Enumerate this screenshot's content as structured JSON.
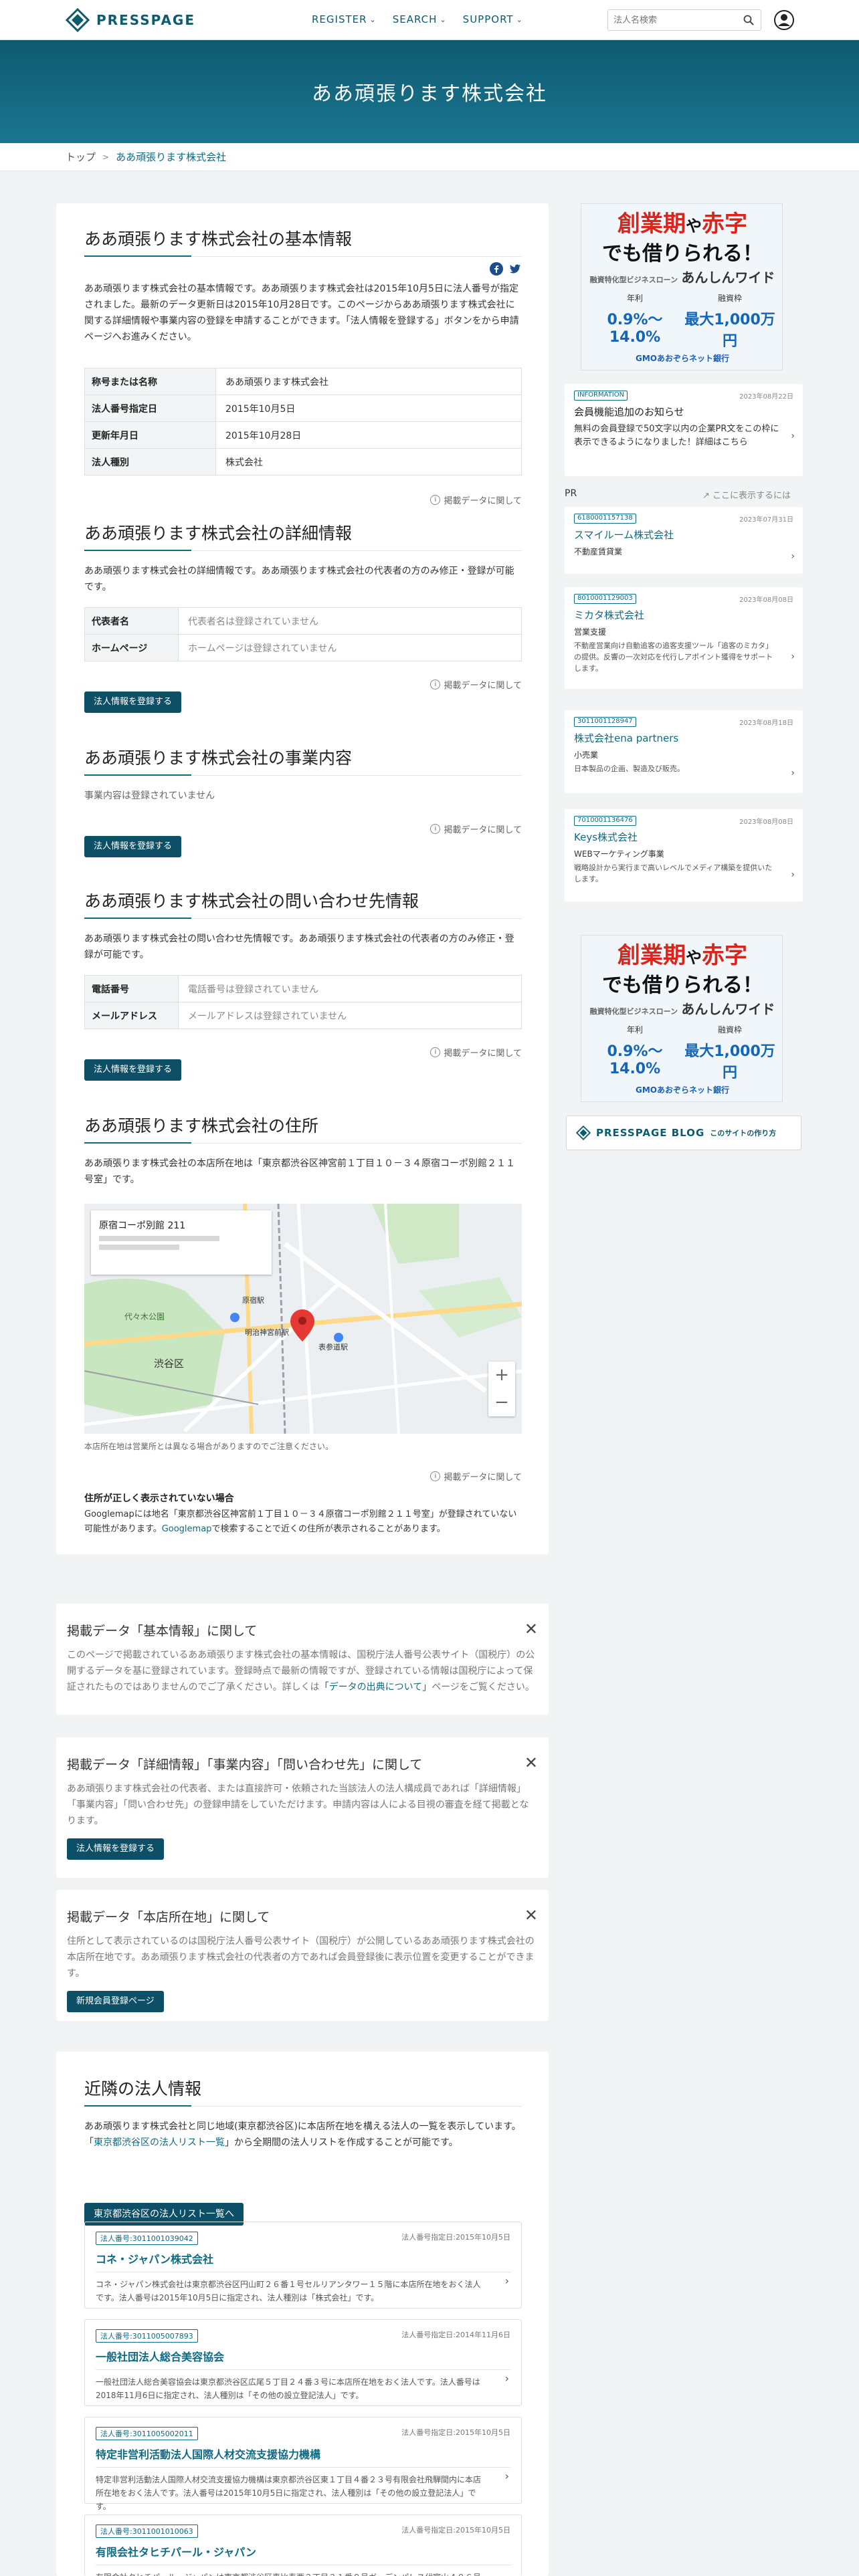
{
  "header": {
    "logo_text": "PRESSPAGE",
    "nav": [
      "REGISTER",
      "SEARCH",
      "SUPPORT"
    ],
    "search_placeholder": "法人名検索"
  },
  "hero": {
    "title": "ああ頑張ります株式会社"
  },
  "breadcrumb": {
    "home": "トップ",
    "sep": ">",
    "current": "ああ頑張ります株式会社"
  },
  "basic": {
    "title": "ああ頑張ります株式会社の基本情報",
    "lead": "ああ頑張ります株式会社の基本情報です。ああ頑張ります株式会社は2015年10月5日に法人番号が指定されました。最新のデータ更新日は2015年10月28日です。このページからああ頑張ります株式会社に関する詳細情報や事業内容の登録を申請することができます。「法人情報を登録する」ボタンをから申請ページへお進みください。",
    "rows": [
      {
        "label": "称号または名称",
        "value": "ああ頑張ります株式会社"
      },
      {
        "label": "法人番号指定日",
        "value": "2015年10月5日"
      },
      {
        "label": "更新年月日",
        "value": "2015年10月28日"
      },
      {
        "label": "法人種別",
        "value": "株式会社"
      }
    ],
    "about": "掲載データに関して"
  },
  "detail": {
    "title": "ああ頑張ります株式会社の詳細情報",
    "lead": "ああ頑張ります株式会社の詳細情報です。ああ頑張ります株式会社の代表者の方のみ修正・登録が可能です。",
    "rows": [
      {
        "label": "代表者名",
        "value": "代表者名は登録されていません"
      },
      {
        "label": "ホームページ",
        "value": "ホームページは登録されていません"
      }
    ],
    "about": "掲載データに関して",
    "button": "法人情報を登録する"
  },
  "business": {
    "title": "ああ頑張ります株式会社の事業内容",
    "lead": "事業内容は登録されていません",
    "about": "掲載データに関して",
    "button": "法人情報を登録する"
  },
  "contact": {
    "title": "ああ頑張ります株式会社の問い合わせ先情報",
    "lead": "ああ頑張ります株式会社の問い合わせ先情報です。ああ頑張ります株式会社の代表者の方のみ修正・登録が可能です。",
    "rows": [
      {
        "label": "電話番号",
        "value": "電話番号は登録されていません"
      },
      {
        "label": "メールアドレス",
        "value": "メールアドレスは登録されていません"
      }
    ],
    "about": "掲載データに関して",
    "button": "法人情報を登録する"
  },
  "address": {
    "title": "ああ頑張ります株式会社の住所",
    "lead": "ああ頑張ります株式会社の本店所在地は「東京都渋谷区神宮前１丁目１０－３４原宿コーポ別館２１１号室」です。",
    "map_card_title": "原宿コーポ別館 211",
    "map_labels": [
      "渋谷区",
      "代々木公園",
      "明治神宮前駅",
      "表参道駅",
      "原宿駅"
    ],
    "map_note": "本店所在地は営業所とは異なる場合がありますのでご注意ください。",
    "about": "掲載データに関して",
    "warn_title": "住所が正しく表示されていない場合",
    "warn_text_1": "Googlemapには地名「東京都渋谷区神宮前１丁目１０－３４原宿コーポ別館２１１号室」が登録されていない可能性があります。",
    "warn_link": "Googlemap",
    "warn_text_2": "で検索することで近くの住所が表示されることがあります。"
  },
  "notices": [
    {
      "title": "掲載データ「基本情報」に関して",
      "text": "このページで掲載されているああ頑張ります株式会社の基本情報は、国税庁法人番号公表サイト（国税庁）の公開するデータを基に登録されています。登録時点で最新の情報ですが、登録されている情報は国税庁によって保証されたものではありませんのでご了承ください。詳しくは",
      "link": "「データの出典について」",
      "text_after": "ページをご覧ください。"
    },
    {
      "title": "掲載データ「詳細情報」「事業内容」「問い合わせ先」に関して",
      "text": "ああ頑張ります株式会社の代表者、または直接許可・依頼された当該法人の法人構成員であれば「詳細情報」「事業内容」「問い合わせ先」の登録申請をしていただけます。申請内容は人による目視の審査を経て掲載となります。",
      "button": "法人情報を登録する"
    },
    {
      "title": "掲載データ「本店所在地」に関して",
      "text": "住所として表示されているのは国税庁法人番号公表サイト（国税庁）が公開しているああ頑張ります株式会社の本店所在地です。ああ頑張ります株式会社の代表者の方であれば会員登録後に表示位置を変更することができます。",
      "button": "新規会員登録ページ"
    }
  ],
  "nearby": {
    "title": "近隣の法人情報",
    "lead_1": "ああ頑張ります株式会社と同じ地域(東京都渋谷区)に本店所在地を構える法人の一覧を表示しています。「",
    "lead_link": "東京都渋谷区の法人リスト一覧",
    "lead_2": "」から全期間の法人リストを作成することが可能です。",
    "button": "東京都渋谷区の法人リスト一覧へ",
    "cards": [
      {
        "number": "法人番号:3011001039042",
        "date": "法人番号指定日:2015年10月5日",
        "name": "コネ・ジャパン株式会社",
        "desc": "コネ・ジャパン株式会社は東京都渋谷区円山町２６番１号セルリアンタワー１５階に本店所在地をおく法人です。法人番号は2015年10月5日に指定され、法人種別は「株式会社」です。"
      },
      {
        "number": "法人番号:3011005007893",
        "date": "法人番号指定日:2014年11月6日",
        "name": "一般社団法人総合美容協会",
        "desc": "一般社団法人総合美容協会は東京都渋谷区広尾５丁目２４番３号に本店所在地をおく法人です。法人番号は2018年11月6日に指定され、法人種別は「その他の設立登記法人」です。"
      },
      {
        "number": "法人番号:3011005002011",
        "date": "法人番号指定日:2015年10月5日",
        "name": "特定非営利活動法人国際人材交流支援協力機構",
        "desc": "特定非営利活動法人国際人材交流支援協力機構は東京都渋谷区東１丁目４番２３号有限会社飛騨間内に本店所在地をおく法人です。法人番号は2015年10月5日に指定され、法人種別は「その他の設立登記法人」です。"
      },
      {
        "number": "法人番号:3011001010063",
        "date": "法人番号指定日:2015年10月5日",
        "name": "有限会社タヒチパール・ジャパン",
        "desc": "有限会社タヒチパール・ジャパンは東京都渋谷区恵比寿西２丁目２１番８号ガーデンパレス代官山４０６号に本"
      }
    ]
  },
  "sidebar": {
    "ad": {
      "line1_a": "創業期",
      "line1_b": "や",
      "line1_c": "赤字",
      "line2": "でも借りられる！",
      "sub_a": "融資特化型ビジネスローン",
      "sub_b": "あんしんワイド",
      "rate_label": "年利",
      "rate_value": "0.9%～14.0%",
      "limit_label": "融資枠",
      "limit_value": "最大1,000万円",
      "bank": "GMOあおぞらネット銀行"
    },
    "info_card": {
      "badge": "INFORMATION",
      "date": "2023年08月22日",
      "title": "会員機能追加のお知らせ",
      "text": "無料の会員登録で50文字以内の企業PR文をこの枠に表示できるようになりました！詳細はこちら"
    },
    "pr_label": "PR",
    "pr_link": "ここに表示するには",
    "pr_cards": [
      {
        "number": "6180001157138",
        "date": "2023年07月31日",
        "name": "スマイルーム株式会社",
        "cat": "不動産賃貸業",
        "desc": ""
      },
      {
        "number": "8010001129003",
        "date": "2023年08月08日",
        "name": "ミカタ株式会社",
        "cat": "営業支援",
        "desc": "不動産営業向け自動追客の追客支援ツール「追客のミカタ」の提供。反響の一次対応を代行しアポイント獲得をサポートします。"
      },
      {
        "number": "3011001128947",
        "date": "2023年08月18日",
        "name": "株式会社ena partners",
        "cat": "小売業",
        "desc": "日本製品の企画、製造及び販売。"
      },
      {
        "number": "7010001136476",
        "date": "2023年08月08日",
        "name": "Keys株式会社",
        "cat": "WEBマーケティング事業",
        "desc": "戦略設計から実行まで高いレベルでメディア構築を提供いたします。"
      }
    ],
    "blog": {
      "text": "PRESSPAGE BLOG",
      "sub": "このサイトの作り方"
    }
  }
}
